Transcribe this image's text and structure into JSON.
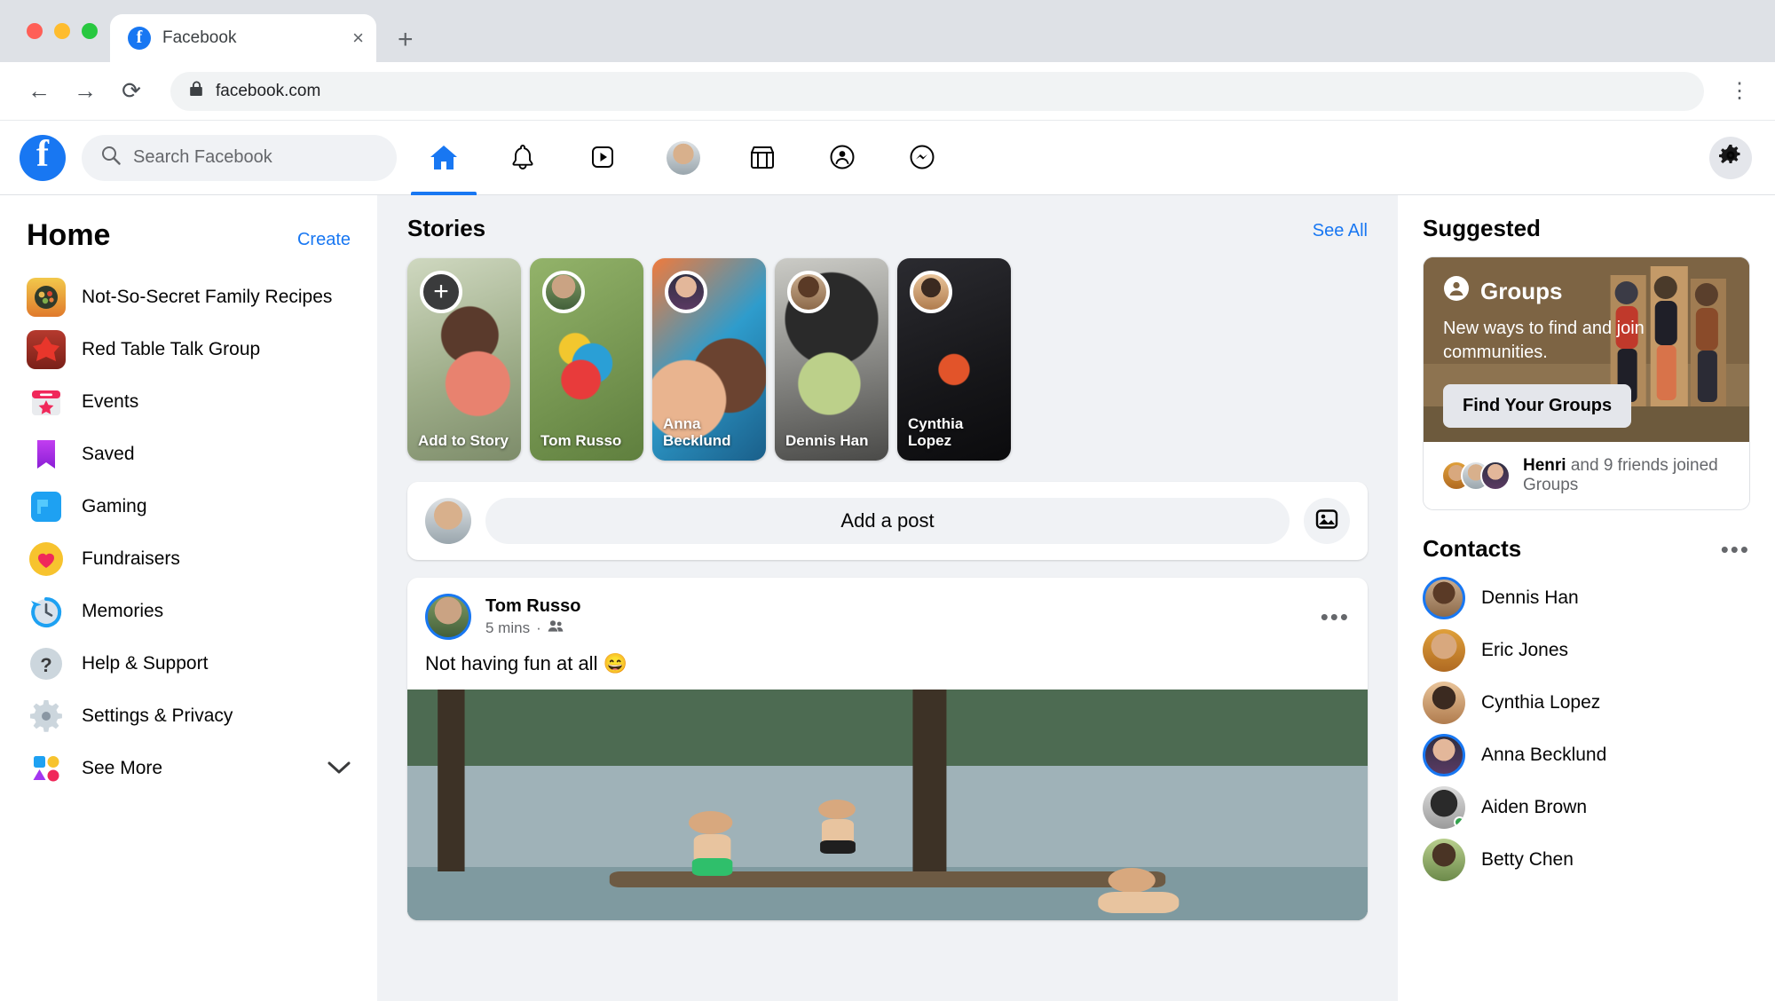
{
  "browser": {
    "tab_title": "Facebook",
    "tab_favicon": "f",
    "close_label": "×",
    "newtab_label": "+",
    "back_label": "←",
    "forward_label": "→",
    "reload_label": "⟳",
    "lock_label": "🔒",
    "url": "facebook.com",
    "menu_label": "⋮"
  },
  "header": {
    "logo_letter": "f",
    "search_placeholder": "Search Facebook",
    "search_value": "",
    "nav": [
      {
        "name": "home",
        "label": "Home",
        "active": true
      },
      {
        "name": "notifications",
        "label": "Notifications",
        "active": false
      },
      {
        "name": "watch",
        "label": "Watch",
        "active": false
      },
      {
        "name": "profile",
        "label": "Profile",
        "active": false
      },
      {
        "name": "marketplace",
        "label": "Marketplace",
        "active": false
      },
      {
        "name": "groups",
        "label": "Groups",
        "active": false
      },
      {
        "name": "messenger",
        "label": "Messenger",
        "active": false
      }
    ],
    "settings_label": "Settings"
  },
  "sidebar": {
    "title": "Home",
    "create_label": "Create",
    "items": [
      {
        "label": "Not-So-Secret Family Recipes",
        "icon": "group-photo-icon",
        "style": "gi1"
      },
      {
        "label": "Red Table Talk Group",
        "icon": "group-photo-icon",
        "style": "gi2"
      },
      {
        "label": "Events",
        "icon": "calendar-star-icon",
        "style": "events"
      },
      {
        "label": "Saved",
        "icon": "bookmark-icon",
        "style": "saved"
      },
      {
        "label": "Gaming",
        "icon": "gaming-icon",
        "style": "gaming"
      },
      {
        "label": "Fundraisers",
        "icon": "heart-icon",
        "style": "fundraisers"
      },
      {
        "label": "Memories",
        "icon": "clock-rewind-icon",
        "style": "memories"
      },
      {
        "label": "Help & Support",
        "icon": "question-mark-icon",
        "style": "help"
      },
      {
        "label": "Settings & Privacy",
        "icon": "gear-icon",
        "style": "settings"
      },
      {
        "label": "See More",
        "icon": "see-more-icon",
        "style": "seemore",
        "chevron": "⌄"
      }
    ]
  },
  "stories": {
    "title": "Stories",
    "see_all_label": "See All",
    "items": [
      {
        "name": "Add to Story",
        "is_add": true,
        "plus": "+",
        "bg": "ph1",
        "avatar": ""
      },
      {
        "name": "Tom Russo",
        "is_add": false,
        "bg": "ph2",
        "avatar": "pa1"
      },
      {
        "name": "Anna Becklund",
        "is_add": false,
        "bg": "ph3",
        "avatar": "pa3"
      },
      {
        "name": "Dennis Han",
        "is_add": false,
        "bg": "ph4",
        "avatar": "pa5"
      },
      {
        "name": "Cynthia Lopez",
        "is_add": false,
        "bg": "ph5",
        "avatar": "pa6"
      }
    ]
  },
  "composer": {
    "placeholder": "Add a post",
    "photo_icon": "photo-icon"
  },
  "post": {
    "author": "Tom Russo",
    "time": "5 mins",
    "separator": "·",
    "audience_icon": "friends-icon",
    "menu_label": "•••",
    "text": "Not having fun at all 😄"
  },
  "suggested": {
    "title": "Suggested",
    "card": {
      "badge": "Groups",
      "badge_icon": "groups-icon",
      "description": "New ways to find and join communities.",
      "button_label": "Find Your Groups",
      "footer_text": "and 9 friends joined Groups",
      "footer_name": "Henri"
    }
  },
  "contacts": {
    "title": "Contacts",
    "menu_label": "•••",
    "items": [
      {
        "name": "Dennis Han",
        "ring": true,
        "online": false,
        "style": "pa5"
      },
      {
        "name": "Eric Jones",
        "ring": false,
        "online": false,
        "style": "pa4"
      },
      {
        "name": "Cynthia Lopez",
        "ring": false,
        "online": false,
        "style": "pa6"
      },
      {
        "name": "Anna Becklund",
        "ring": true,
        "online": false,
        "style": "pa3"
      },
      {
        "name": "Aiden Brown",
        "ring": false,
        "online": true,
        "style": "pa7"
      },
      {
        "name": "Betty Chen",
        "ring": false,
        "online": false,
        "style": "pa8"
      }
    ]
  },
  "colors": {
    "brand_blue": "#1877f2",
    "bg_gray": "#f0f2f5",
    "online_green": "#31a24c"
  }
}
